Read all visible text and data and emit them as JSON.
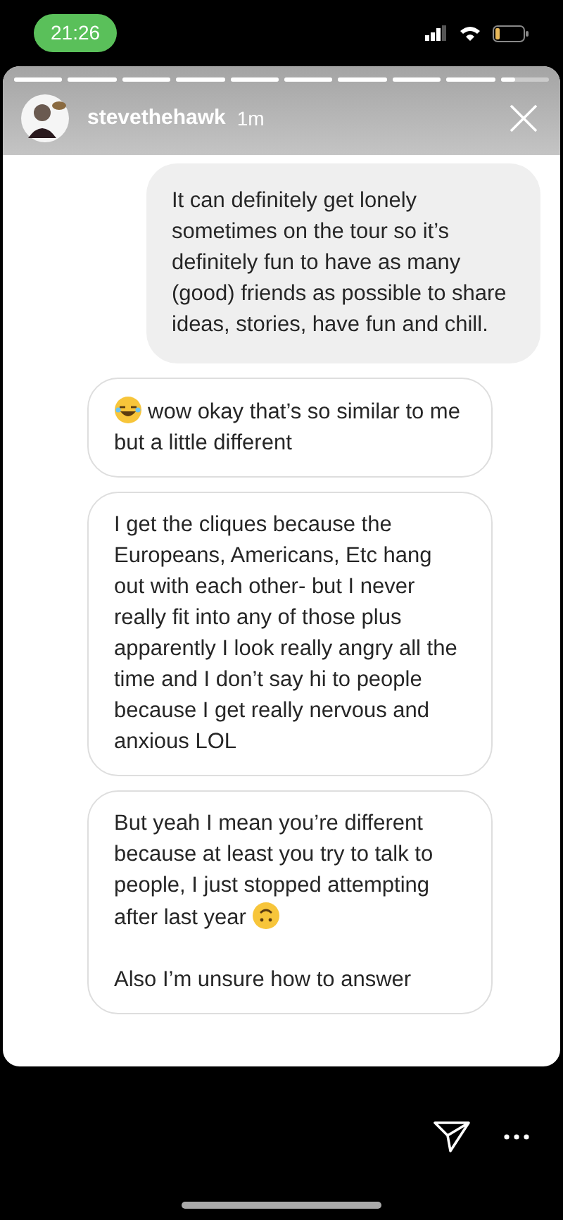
{
  "status_bar": {
    "time": "21:26"
  },
  "story": {
    "segments": [
      {
        "level": 1
      },
      {
        "level": 1
      },
      {
        "level": 1
      },
      {
        "level": 1
      },
      {
        "level": 1
      },
      {
        "level": 1
      },
      {
        "level": 1
      },
      {
        "level": 1
      },
      {
        "level": 1
      },
      {
        "level": 0.3
      }
    ],
    "username": "stevethehawk",
    "age": "1m"
  },
  "messages": [
    {
      "kind": "sent",
      "parts": [
        {
          "kind": "text",
          "text": "It can definitely get lonely sometimes on the tour so it’s definitely fun to have as many (good) friends as possible to share ideas, stories, have fun and chill."
        }
      ]
    },
    {
      "kind": "received",
      "parts": [
        {
          "kind": "laughing_emoji"
        },
        {
          "kind": "text",
          "text": "wow okay that’s so similar to me but a little different"
        }
      ]
    },
    {
      "kind": "received",
      "parts": [
        {
          "kind": "text",
          "text": "I get the cliques because the Europeans, Americans, Etc hang out with each other- but I never really fit into any of those plus apparently I look really angry all the time and I don’t say hi to people because I get really nervous and anxious LOL"
        }
      ]
    },
    {
      "kind": "received",
      "parts": [
        {
          "kind": "text",
          "text": "But yeah I mean you’re different because at least you try to talk to people, I just stopped attempting after last year"
        },
        {
          "kind": "upside_down_emoji"
        }
      ],
      "text_2": "Also I’m unsure how to answer"
    }
  ]
}
